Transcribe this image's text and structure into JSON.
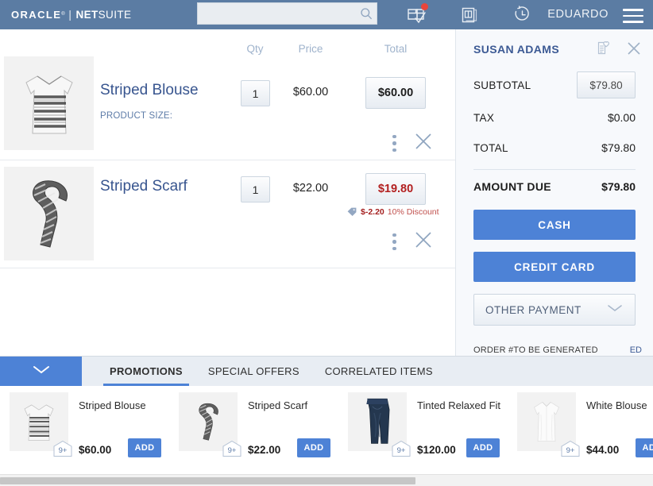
{
  "header": {
    "brand": {
      "oracle": "ORACLE",
      "reg": "®",
      "separator": "|",
      "net": "NET",
      "suite": "SUITE"
    },
    "search": {
      "value": "",
      "placeholder": ""
    },
    "icons": [
      {
        "name": "package-check-icon",
        "badge": true
      },
      {
        "name": "hold-transaction-icon",
        "badge": false
      },
      {
        "name": "history-clock-icon",
        "badge": false
      }
    ],
    "user": "EDUARDO",
    "menu_icon": "hamburger-menu-icon"
  },
  "cart": {
    "columns": {
      "qty": "Qty",
      "price": "Price",
      "total": "Total"
    },
    "items": [
      {
        "name": "Striped Blouse",
        "sublabel": "PRODUCT SIZE:",
        "qty": "1",
        "price": "$60.00",
        "total": "$60.00",
        "discounted": false,
        "discount_amount": "",
        "discount_label": "",
        "thumb": "striped-blouse-thumb"
      },
      {
        "name": "Striped Scarf",
        "sublabel": "",
        "qty": "1",
        "price": "$22.00",
        "total": "$19.80",
        "discounted": true,
        "discount_amount": "$-2.20",
        "discount_label": "10% Discount",
        "thumb": "striped-scarf-thumb"
      }
    ]
  },
  "panel": {
    "customer": "SUSAN ADAMS",
    "wishlist_icon": "document-heart-icon",
    "close_icon": "close-icon",
    "subtotal_label": "SUBTOTAL",
    "subtotal_value": "$79.80",
    "tax_label": "TAX",
    "tax_value": "$0.00",
    "total_label": "TOTAL",
    "total_value": "$79.80",
    "amount_due_label": "AMOUNT DUE",
    "amount_due_value": "$79.80",
    "cash_label": "CASH",
    "credit_card_label": "CREDIT CARD",
    "other_payment_label": "OTHER PAYMENT",
    "order_number": "ORDER #TO BE GENERATED",
    "order_employee": "ED"
  },
  "tabbar": {
    "collapse_icon": "chevron-down-icon",
    "tabs": [
      {
        "label": "PROMOTIONS",
        "active": true
      },
      {
        "label": "SPECIAL OFFERS",
        "active": false
      },
      {
        "label": "CORRELATED ITEMS",
        "active": false
      }
    ]
  },
  "carousel": {
    "add_label": "ADD",
    "cards": [
      {
        "name": "Striped Blouse",
        "price": "$60.00",
        "stock": "9+",
        "thumb": "striped-blouse-thumb"
      },
      {
        "name": "Striped Scarf",
        "price": "$22.00",
        "stock": "9+",
        "thumb": "striped-scarf-thumb"
      },
      {
        "name": "Tinted Relaxed Fit",
        "price": "$120.00",
        "stock": "9+",
        "thumb": "jeans-thumb"
      },
      {
        "name": "White Blouse",
        "price": "$44.00",
        "stock": "9+",
        "thumb": "white-blouse-thumb"
      }
    ]
  },
  "colors": {
    "header_blue": "#5b7ca3",
    "accent_blue": "#4d82d6",
    "link_blue": "#38558f",
    "discount_red": "#a41f1f",
    "panel_bg": "#f7f9fc",
    "badge_red": "#e8453c"
  }
}
